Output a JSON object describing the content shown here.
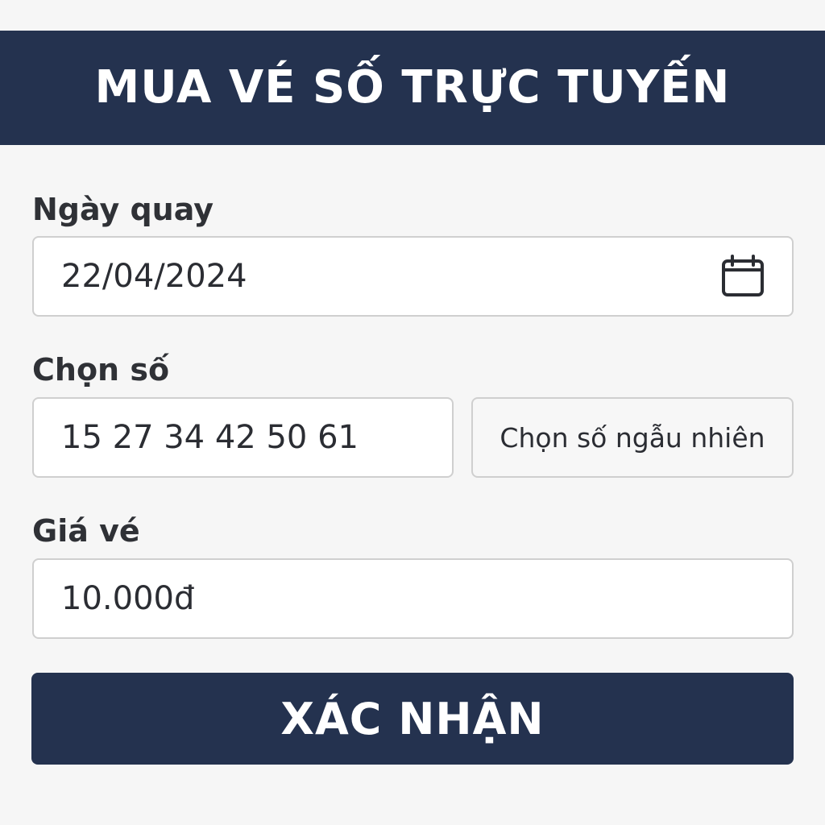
{
  "header": {
    "title": "MUA VÉ SỐ TRỰC TUYẾN"
  },
  "draw_date": {
    "label": "Ngày quay",
    "value": "22/04/2024",
    "icon": "calendar-icon"
  },
  "numbers": {
    "label": "Chọn số",
    "value": "15 27 34 42 50 61",
    "random_button_label": "Chọn số ngẫu nhiên"
  },
  "price": {
    "label": "Giá vé",
    "value": "10.000đ"
  },
  "confirm_button_label": "XÁC NHẬN",
  "colors": {
    "primary": "#24324f",
    "background": "#f6f6f6",
    "border": "#cfcfcf"
  }
}
